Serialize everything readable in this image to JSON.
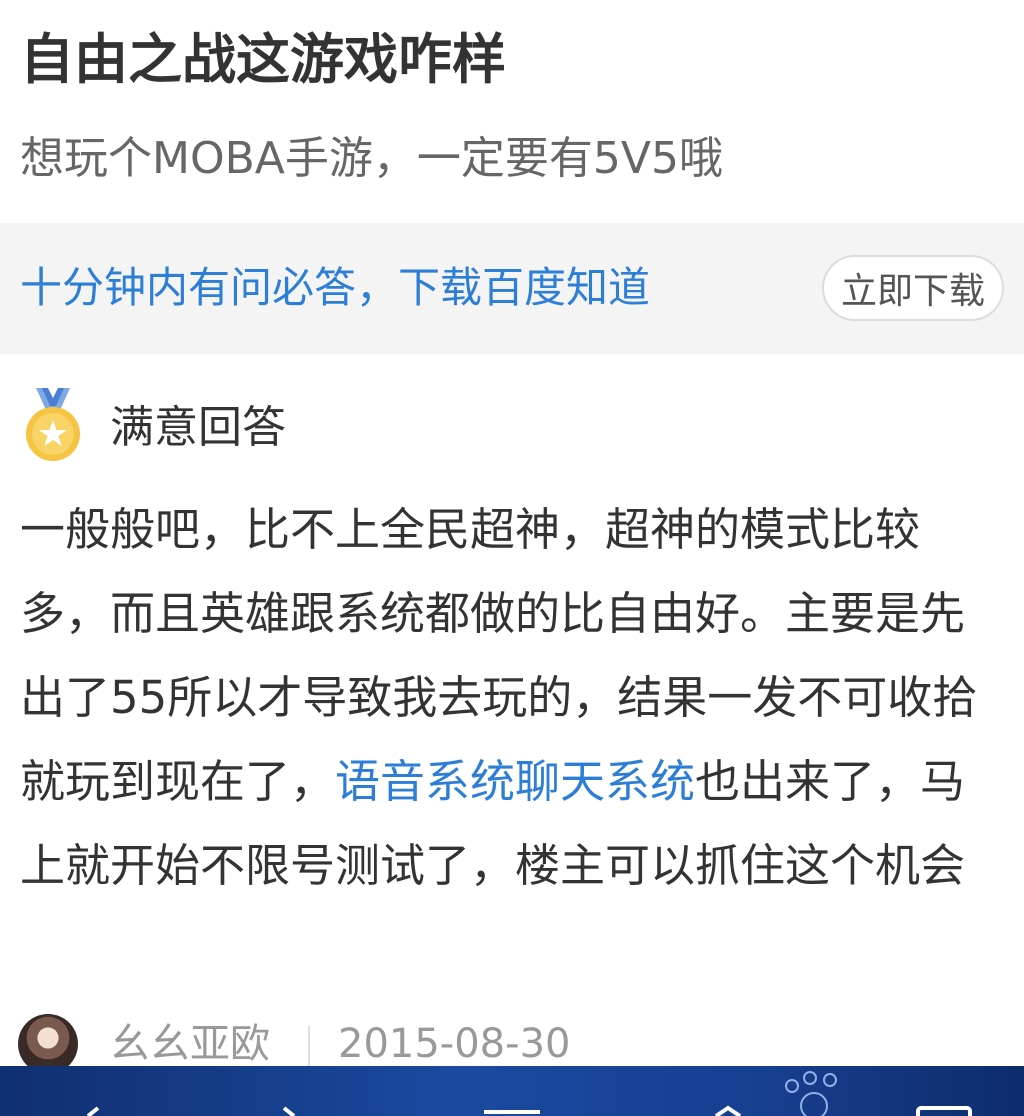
{
  "question": {
    "title": "自由之战这游戏咋样",
    "description": "想玩个MOBA手游，一定要有5V5哦"
  },
  "banner": {
    "text": "十分钟内有问必答，下载百度知道",
    "button_label": "立即下载"
  },
  "answer": {
    "badge_icon": "medal-icon",
    "label": "满意回答",
    "text_before": "一般般吧，比不上全民超神，超神的模式比较多，而且英雄跟系统都做的比自由好。主要是先出了55所以才导致我去玩的，结果一发不可收拾就玩到现在了，",
    "link_text": "语音系统聊天系统",
    "text_after": "也出来了，马上就开始不限号测试了，楼主可以抓住这个机会",
    "author": "幺幺亚欧",
    "date": "2015-08-30"
  },
  "bottom_bar": {
    "icons": [
      "back-icon",
      "forward-icon",
      "menu-icon",
      "home-icon",
      "tabs-icon"
    ]
  },
  "colors": {
    "link": "#2d7ed6",
    "banner_bg": "#f4f4f5",
    "bottom_bar": "#163f8f"
  }
}
